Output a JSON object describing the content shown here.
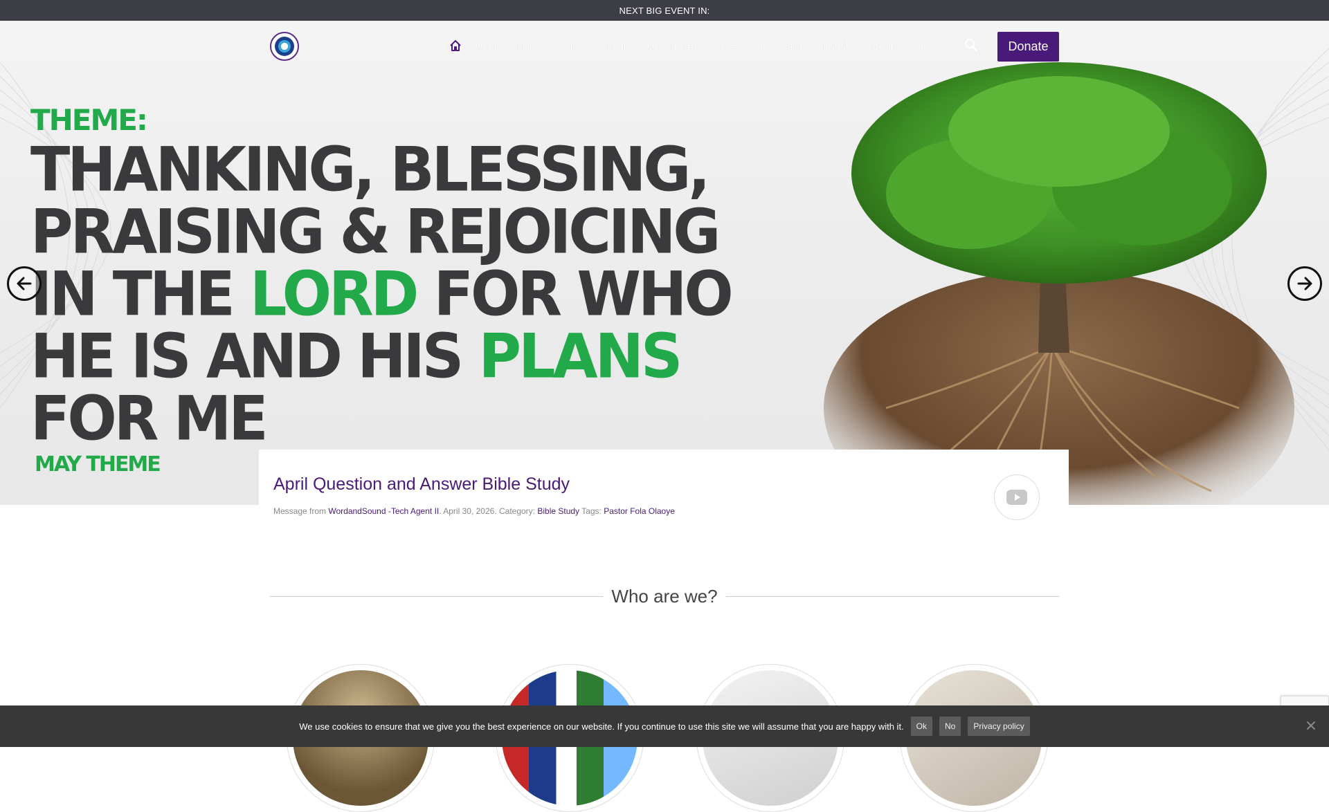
{
  "topbar": {
    "text": "NEXT BIG EVENT IN:"
  },
  "nav": {
    "logo_name": "church-logo",
    "items": [
      {
        "label": "About"
      },
      {
        "label": "Sermons"
      },
      {
        "label": "Events"
      },
      {
        "label": "Children"
      },
      {
        "label": "Teens"
      },
      {
        "label": "LIGHT CHURCH"
      },
      {
        "label": "LADC"
      },
      {
        "label": "Blog"
      },
      {
        "label": "Contact Us"
      },
      {
        "label": "Giving"
      },
      {
        "label": "Store"
      }
    ],
    "donate_label": "Donate"
  },
  "hero": {
    "label": "THEME:",
    "lines": [
      [
        "THANKING, BLESSING,"
      ],
      [
        "PRAISING & REJOICING"
      ],
      [
        "IN THE ",
        "LORD",
        " FOR WHO"
      ],
      [
        "HE IS AND HIS ",
        "PLANS"
      ],
      [
        "FOR ME"
      ]
    ],
    "line1": "THANKING, BLESSING,",
    "line2": "PRAISING & REJOICING",
    "line3a": "IN THE ",
    "line3b": "LORD",
    "line3c": " FOR WHO",
    "line4a": "HE IS AND HIS ",
    "line4b": "PLANS",
    "line5": "FOR ME",
    "footer": "MAY THEME",
    "accent": "#22a94a",
    "text_color": "#3a3a3c"
  },
  "feature": {
    "title": "April Question and Answer Bible Study",
    "meta_prefix": "Message from ",
    "author": "WordandSound -Tech Agent II",
    "date_text": ". April 30, 2026. Category: ",
    "category": "Bible Study",
    "tags_label": " Tags: ",
    "tag": "Pastor Fola Olaoye"
  },
  "who": {
    "heading": "Who are we?"
  },
  "cookie": {
    "message": "We use cookies to ensure that we give you the best experience on our website. If you continue to use this site we will assume that you are happy with it.",
    "ok_label": "Ok",
    "no_label": "No",
    "privacy_label": "Privacy policy"
  },
  "colors": {
    "brand": "#4a1a7a",
    "topbar": "#3d3e45",
    "cookie_bg": "#383838"
  }
}
